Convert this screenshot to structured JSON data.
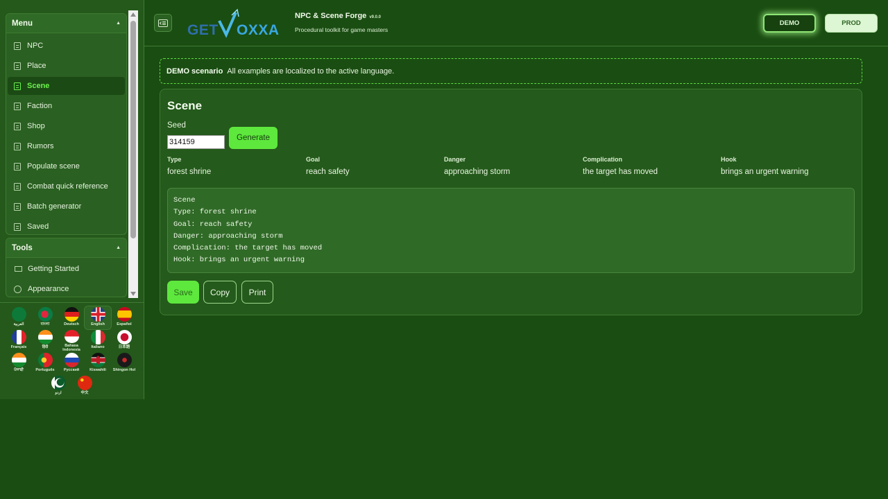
{
  "header": {
    "brand_logo": "GETVOXXA",
    "app_title": "NPC & Scene Forge",
    "app_version": "v9.0.0",
    "app_subtitle": "Procedural toolkit for game masters",
    "env_demo": "DEMO",
    "env_prod": "PROD"
  },
  "sidebar": {
    "menu_title": "Menu",
    "menu_items": [
      "NPC",
      "Place",
      "Scene",
      "Faction",
      "Shop",
      "Rumors",
      "Populate scene",
      "Combat quick reference",
      "Batch generator",
      "Saved"
    ],
    "active_item": "Scene",
    "tools_title": "Tools",
    "tools_items": [
      "Getting Started",
      "Appearance"
    ],
    "languages": [
      [
        "العربية",
        "বাংলা",
        "Deutsch",
        "English",
        "Español"
      ],
      [
        "Français",
        "हिंदी",
        "Bahasa Indonesia",
        "Italiano",
        "日本語"
      ],
      [
        "ਪੰਜਾਬੀ",
        "Português",
        "Русский",
        "Kiswahili",
        "Shingon Hol"
      ],
      [
        "اردو",
        "中文"
      ]
    ],
    "active_language": "English"
  },
  "banner": {
    "label": "DEMO scenario",
    "text": "All examples are localized to the active language."
  },
  "scene": {
    "title": "Scene",
    "seed_label": "Seed",
    "seed_value": "314159",
    "generate_label": "Generate",
    "fields": [
      {
        "label": "Type",
        "value": "forest shrine"
      },
      {
        "label": "Goal",
        "value": "reach safety"
      },
      {
        "label": "Danger",
        "value": "approaching storm"
      },
      {
        "label": "Complication",
        "value": "the target has moved"
      },
      {
        "label": "Hook",
        "value": "brings an urgent warning"
      }
    ],
    "output_lines": [
      "Scene",
      "Type: forest shrine",
      "Goal: reach safety",
      "Danger: approaching storm",
      "Complication: the target has moved",
      "Hook: brings an urgent warning"
    ],
    "actions": {
      "save": "Save",
      "copy": "Copy",
      "print": "Print"
    }
  },
  "colors": {
    "background": "#1a4d12",
    "sidebar": "#24591b",
    "accent": "#5ee83d",
    "active_text": "#6cf24e"
  }
}
